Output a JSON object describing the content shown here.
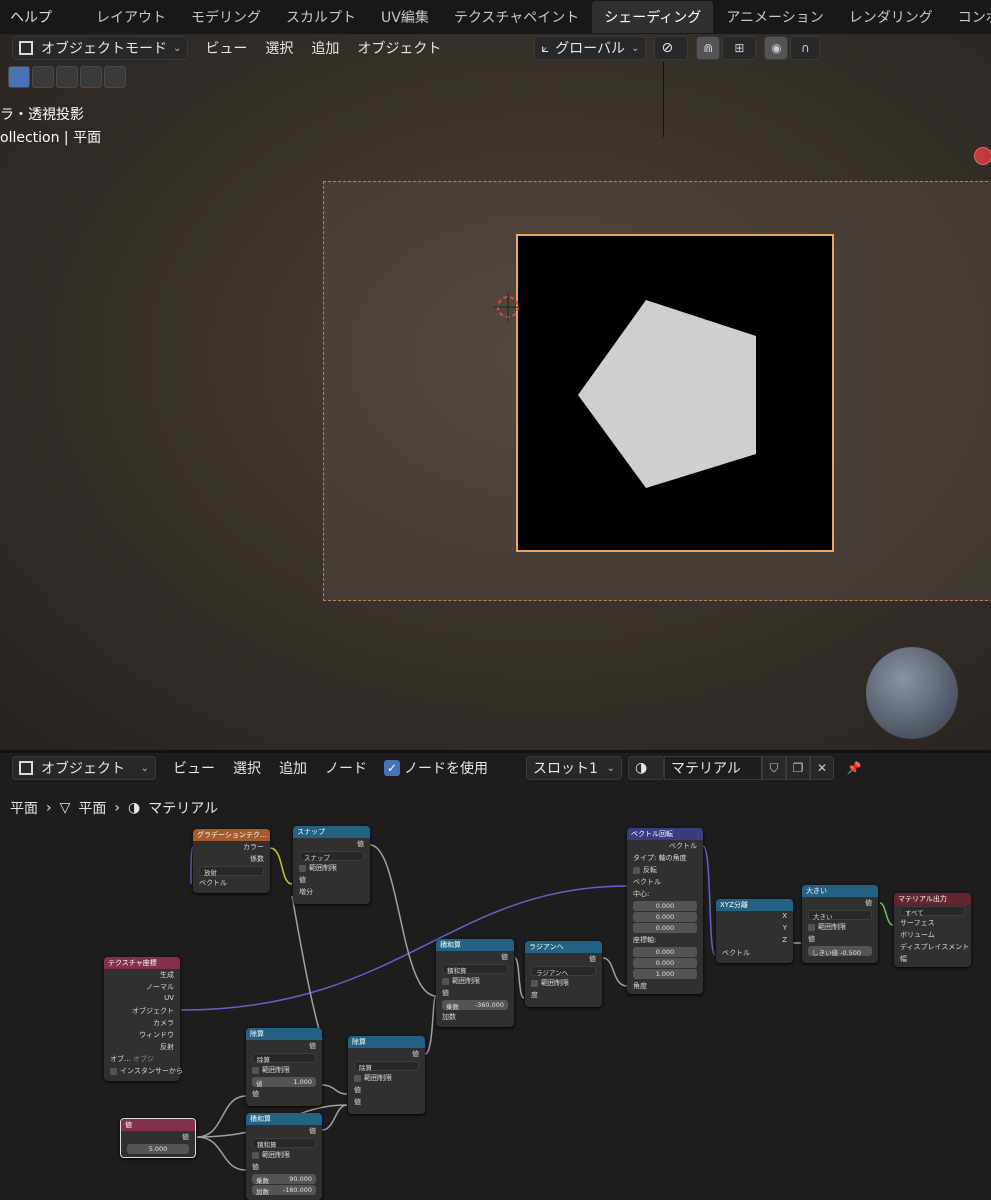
{
  "topbar": {
    "help": "ヘルプ",
    "tabs": [
      "レイアウト",
      "モデリング",
      "スカルプト",
      "UV編集",
      "テクスチャペイント",
      "シェーディング",
      "アニメーション",
      "レンダリング",
      "コンポ"
    ],
    "active_tab": "シェーディング"
  },
  "viewport_header": {
    "mode": "オブジェクトモード",
    "menus": [
      "ビュー",
      "選択",
      "追加",
      "オブジェクト"
    ],
    "orientation": "グローバル"
  },
  "viewport": {
    "title": "ラ・透視投影",
    "subtitle": "ollection | 平面"
  },
  "node_editor_header": {
    "type": "オブジェクト",
    "menus": [
      "ビュー",
      "選択",
      "追加",
      "ノード"
    ],
    "use_nodes_label": "ノードを使用",
    "slot": "スロット1",
    "material": "マテリアル"
  },
  "breadcrumb": [
    "平面",
    "平面",
    "マテリアル"
  ],
  "nodes": {
    "gradient": {
      "title": "グラデーションテク...",
      "out1": "カラー",
      "out2": "係数",
      "mode": "放射",
      "in1": "ベクトル"
    },
    "snap": {
      "title": "スナップ",
      "out": "値",
      "op": "スナップ",
      "clamp": "範囲制限",
      "in1": "値",
      "in2": "増分"
    },
    "texcoord": {
      "title": "テクスチャ座標",
      "outs": [
        "生成",
        "ノーマル",
        "UV",
        "オブジェクト",
        "カメラ",
        "ウィンドウ",
        "反射"
      ],
      "obj_label": "オブ...",
      "obj_value": "オブジ",
      "instancer": "インスタンサーから"
    },
    "value": {
      "title": "値",
      "out": "値",
      "val": "5.000"
    },
    "divide1": {
      "title": "除算",
      "out": "値",
      "op": "除算",
      "clamp": "範囲制限",
      "field": "値",
      "field_val": "1.000",
      "in": "値"
    },
    "multadd1": {
      "title": "積和算",
      "out": "値",
      "op": "積和算",
      "clamp": "範囲制限",
      "in": "値",
      "mult_label": "乗数",
      "mult_val": "90.000",
      "add_label": "加数",
      "add_val": "-180.000"
    },
    "divide2": {
      "title": "除算",
      "out": "値",
      "op": "除算",
      "clamp": "範囲制限",
      "in1": "値",
      "in2": "値"
    },
    "multadd2": {
      "title": "積和算",
      "out": "値",
      "op": "積和算",
      "clamp": "範囲制限",
      "in": "値",
      "mult_label": "乗数",
      "mult_val": "-360.000",
      "add_label": "加数"
    },
    "toradians": {
      "title": "ラジアンへ",
      "out": "値",
      "op": "ラジアンへ",
      "clamp": "範囲制限",
      "in": "度"
    },
    "vecrotate": {
      "title": "ベクトル回転",
      "out": "ベクトル",
      "type_label": "タイプ:",
      "type_val": "軸の角度",
      "invert": "反転",
      "in_vec": "ベクトル",
      "center": "中心:",
      "c": [
        "0.000",
        "0.000",
        "0.000"
      ],
      "axis": "座標軸:",
      "a": [
        "0.000",
        "0.000",
        "1.000"
      ],
      "angle": "角度"
    },
    "sepxyz": {
      "title": "XYZ分離",
      "outs": [
        "X",
        "Y",
        "Z"
      ],
      "in": "ベクトル"
    },
    "greater": {
      "title": "大きい",
      "out": "値",
      "op": "大きい",
      "clamp": "範囲制限",
      "in": "値",
      "thresh_label": "しきい値",
      "thresh_val": "-0.500"
    },
    "matout": {
      "title": "マテリアル出力",
      "target": "すべて",
      "ins": [
        "サーフェス",
        "ボリューム",
        "ディスプレイスメント",
        "幅"
      ]
    }
  },
  "colors": {
    "accent": "#4772b3",
    "active_outline": "#f0a35a"
  }
}
